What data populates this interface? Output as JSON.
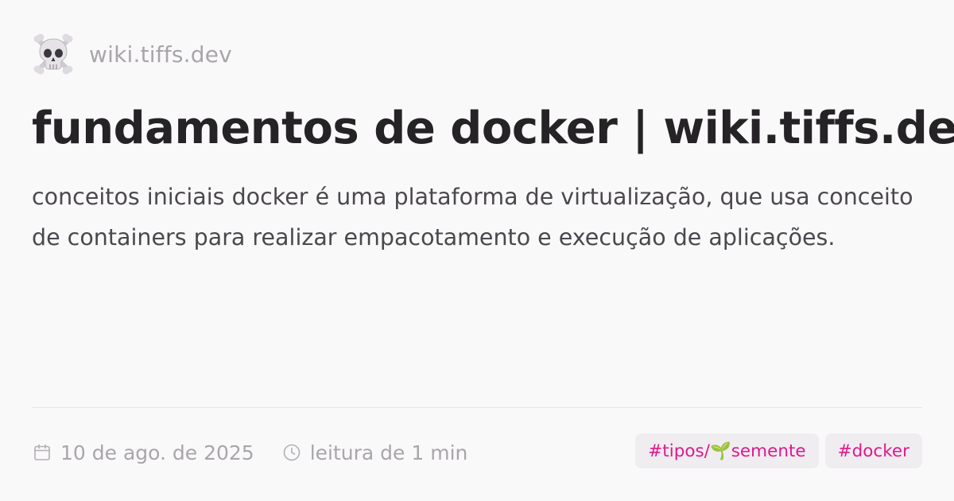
{
  "site": {
    "logo_icon": "skull-and-crossbones-icon",
    "name": "wiki.tiffs.dev"
  },
  "page": {
    "title": "fundamentos de docker | wiki.tiffs.dev",
    "description": "conceitos iniciais docker é uma plataforma de virtualização, que usa conceito de containers para realizar empacotamento e execução de aplicações."
  },
  "meta": {
    "date_icon": "calendar-icon",
    "date": "10 de ago. de 2025",
    "reading_icon": "clock-icon",
    "reading_time": "leitura de 1 min"
  },
  "tags": [
    {
      "label": "#tipos/🌱semente"
    },
    {
      "label": "#docker"
    }
  ],
  "colors": {
    "background": "#faf9fa",
    "title": "#252326",
    "text": "#4b484d",
    "muted": "#a9a5ab",
    "tag_text": "#e0198c",
    "tag_background": "#efedf0"
  }
}
